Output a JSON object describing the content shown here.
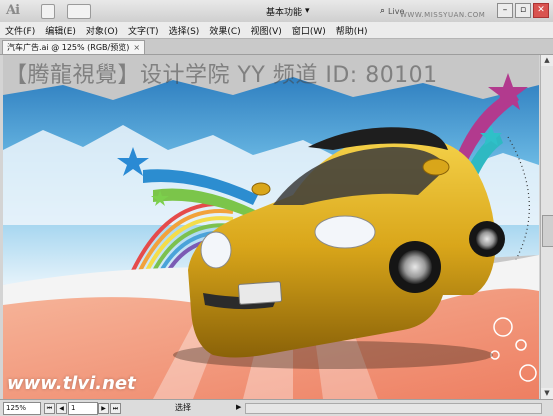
{
  "app": {
    "logo": "Ai"
  },
  "workspace": {
    "label": "基本功能"
  },
  "search": {
    "live_label": "Live"
  },
  "watermark_top": "WWW.MISSYUAN.COM",
  "menu": [
    "文件(F)",
    "编辑(E)",
    "对象(O)",
    "文字(T)",
    "选择(S)",
    "效果(C)",
    "视图(V)",
    "窗口(W)",
    "帮助(H)"
  ],
  "document": {
    "tab_label": "汽车广告.ai @ 125% (RGB/预览)",
    "close": "×"
  },
  "artwork": {
    "watermark": "【腾龍視覺】设计学院 YY 频道 ID: 80101",
    "site": "www.tlvi.net"
  },
  "status": {
    "zoom": "125%",
    "page": "1",
    "tool": "选择"
  },
  "colors": {
    "sky": "#4fa8d8",
    "car": "#d9a61a",
    "road": "#f08f72",
    "accent": "#b23a8e"
  }
}
